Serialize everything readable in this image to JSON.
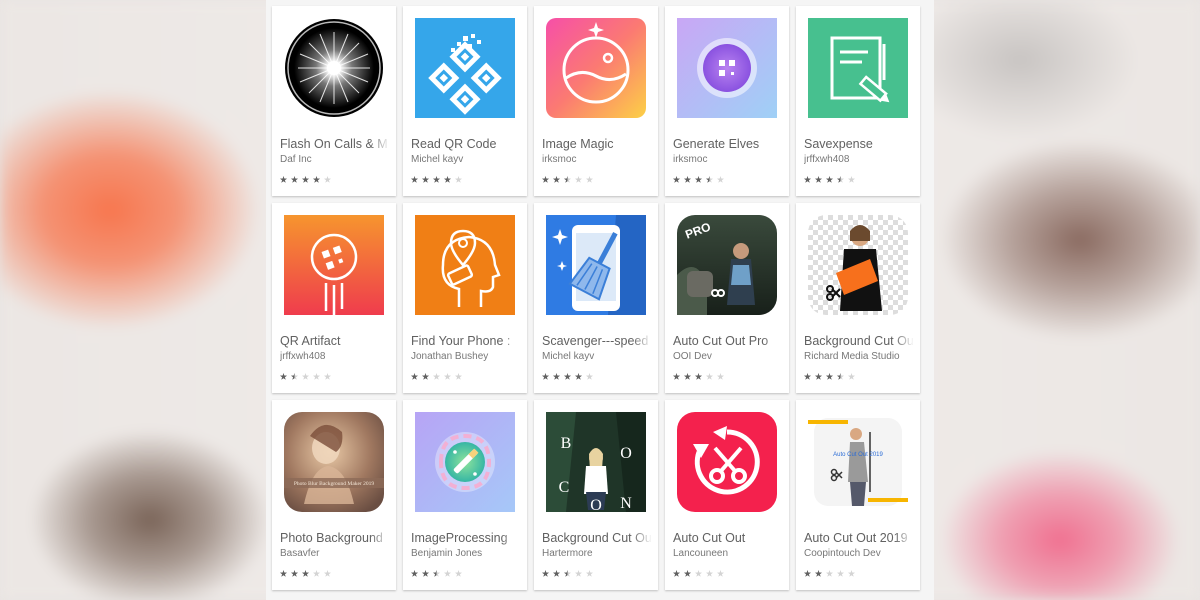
{
  "colors": {
    "star_on": "#616161",
    "star_off": "#d4d4d4"
  },
  "apps": [
    {
      "title": "Flash On Calls & M",
      "developer": "Daf Inc",
      "rating": 4,
      "icon": "flash-icon"
    },
    {
      "title": "Read QR Code",
      "developer": "Michel kayv",
      "rating": 4,
      "icon": "qr-code-icon"
    },
    {
      "title": "Image Magic",
      "developer": "irksmoc",
      "rating": 2.5,
      "icon": "image-magic-icon"
    },
    {
      "title": "Generate Elves",
      "developer": "irksmoc",
      "rating": 3.5,
      "icon": "qr-orb-icon"
    },
    {
      "title": "Savexpense",
      "developer": "jrffxwh408",
      "rating": 3.5,
      "icon": "notepad-pen-icon"
    },
    {
      "title": "QR Artifact",
      "developer": "jrffxwh408",
      "rating": 1.5,
      "icon": "qr-artifact-icon"
    },
    {
      "title": "Find Your Phone :",
      "developer": "Jonathan Bushey",
      "rating": 2,
      "icon": "find-phone-icon"
    },
    {
      "title": "Scavenger---speed",
      "developer": "Michel kayv",
      "rating": 4,
      "icon": "phone-broom-icon"
    },
    {
      "title": "Auto Cut Out Pro",
      "developer": "OOI Dev",
      "rating": 3,
      "icon": "auto-cut-out-pro-icon"
    },
    {
      "title": "Background Cut Ou",
      "developer": "Richard Media Studio",
      "rating": 3.5,
      "icon": "background-cut-person-icon"
    },
    {
      "title": "Photo Background",
      "developer": "Basavfer",
      "rating": 3,
      "icon": "photo-blur-icon"
    },
    {
      "title": "ImageProcessing",
      "developer": "Benjamin Jones",
      "rating": 2.5,
      "icon": "image-processing-icon"
    },
    {
      "title": "Background Cut Ou",
      "developer": "Hartermore",
      "rating": 2.5,
      "icon": "background-cut-bocon-icon"
    },
    {
      "title": "Auto Cut Out",
      "developer": "Lancouneen",
      "rating": 2,
      "icon": "scissors-rotate-icon"
    },
    {
      "title": "Auto Cut Out 2019",
      "developer": "Coopintouch Dev",
      "rating": 2,
      "icon": "auto-cut-2019-icon"
    }
  ],
  "icon_text": {
    "pro_badge": "PRO",
    "bocon_letters": [
      "B",
      "O",
      "C",
      "O",
      "N"
    ],
    "photo_blur_caption": "Photo Blur Background Maker 2019",
    "auto_cut_2019_caption": "Auto Cut Out 2019"
  }
}
